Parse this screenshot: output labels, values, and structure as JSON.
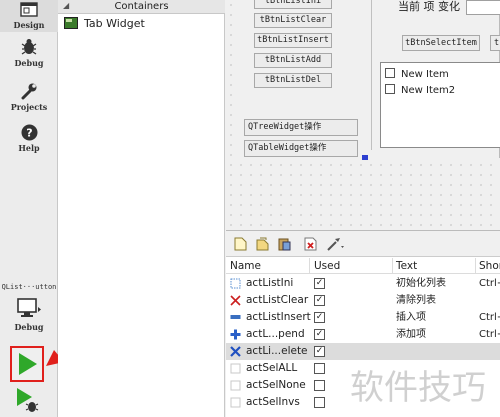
{
  "modes": [
    {
      "label": "Design",
      "icon": "design-icon",
      "active": true
    },
    {
      "label": "Debug",
      "icon": "bug-icon"
    },
    {
      "label": "Projects",
      "icon": "wrench-icon"
    },
    {
      "label": "Help",
      "icon": "help-icon"
    }
  ],
  "kit": {
    "label": "QList···utton",
    "mode_label": "Debug"
  },
  "widget_box": {
    "category": "Containers",
    "item": "Tab Widget"
  },
  "form": {
    "buttons": [
      "tBtnListIni",
      "tBtnListClear",
      "tBtnListInsert",
      "tBtnListAdd",
      "tBtnListDel"
    ],
    "tree_button": "QTreeWidget操作",
    "table_button": "QTableWidget操作",
    "current_item_label": "当前 项 变化",
    "select_item_button": "tBtnSelectItem",
    "select_item_button2": "t",
    "list_items": [
      "New Item",
      "New Item2"
    ]
  },
  "action_editor": {
    "columns": [
      "Name",
      "Used",
      "Text",
      "Shor"
    ],
    "rows": [
      {
        "name": "actListIni",
        "used": "✓",
        "text": "初始化列表",
        "shortcut": "Ctrl+",
        "icon": "list-init-icon",
        "color": "#5a8fd0"
      },
      {
        "name": "actListClear",
        "used": "✓",
        "text": "清除列表",
        "shortcut": "",
        "icon": "clear-x-icon",
        "color": "#cc2020"
      },
      {
        "name": "actListInsert",
        "used": "✓",
        "text": "插入项",
        "shortcut": "Ctrl+",
        "icon": "insert-icon",
        "color": "#3a6fc0"
      },
      {
        "name": "actL...pend",
        "used": "✓",
        "text": "添加项",
        "shortcut": "Ctrl+",
        "icon": "plus-icon",
        "color": "#2a60c8"
      },
      {
        "name": "actLi...elete",
        "used": "✓",
        "text": "",
        "shortcut": "",
        "icon": "delete-x-icon",
        "color": "#2050c0",
        "selected": true
      },
      {
        "name": "actSelALL",
        "used": "",
        "text": "",
        "shortcut": "",
        "icon": "blank-icon"
      },
      {
        "name": "actSelNone",
        "used": "",
        "text": "",
        "shortcut": "",
        "icon": "blank-icon"
      },
      {
        "name": "actSelInvs",
        "used": "",
        "text": "",
        "shortcut": "",
        "icon": "blank-icon"
      }
    ]
  },
  "watermark": "软件技巧",
  "colors": {
    "accent": "#e0201c",
    "run_green": "#2fa82a",
    "handle_blue": "#2d3fd0"
  }
}
